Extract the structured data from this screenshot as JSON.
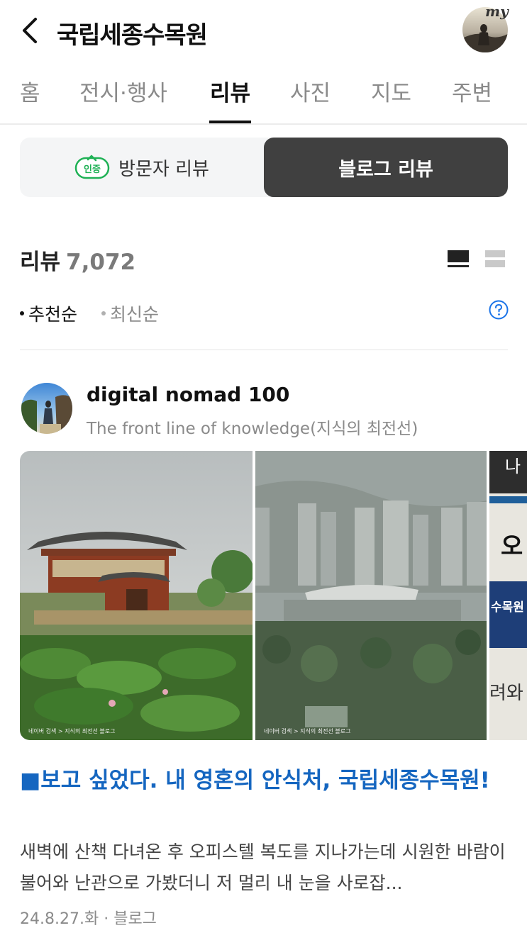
{
  "header": {
    "title": "국립세종수목원",
    "my_badge": "my"
  },
  "tabs": [
    {
      "label": "홈"
    },
    {
      "label": "전시·행사"
    },
    {
      "label": "리뷰"
    },
    {
      "label": "사진"
    },
    {
      "label": "지도"
    },
    {
      "label": "주변"
    }
  ],
  "active_tab": "리뷰",
  "review_toggle": {
    "badge_text": "인증",
    "visitor_label": "방문자 리뷰",
    "blog_label": "블로그 리뷰",
    "selected": "블로그 리뷰"
  },
  "reviews": {
    "label": "리뷰",
    "count": "7,072"
  },
  "sort": {
    "options": [
      "추천순",
      "최신순"
    ],
    "selected": "추천순"
  },
  "post": {
    "author_name": "digital nomad 100",
    "author_desc": "The front line of knowledge(지식의 최전선)",
    "title": "■보고 싶었다. 내 영혼의 안식처, 국립세종수목원!",
    "excerpt": "새벽에 산책 다녀온 후 오피스텔 복도를 지나가는데 시원한 바람이 불어와 난관으로 가봤더니 저 멀리 내 눈을 사로잡...",
    "date": "24.8.27.화",
    "source": "블로그",
    "meta_sep": " · ",
    "photo_watermark": "네이버 검색 > 지식의 최전선 블로그",
    "photo3_text": {
      "t1": "나",
      "t2": "오",
      "t3": "수목원",
      "t4": "려와"
    }
  },
  "colors": {
    "accent_blue": "#1566c0",
    "toggle_dark": "#404040",
    "cert_green": "#1fb155"
  },
  "icons": {
    "back": "chevron-left-icon",
    "view_list": "list-view-icon",
    "view_grid": "grid-view-icon",
    "help": "question-circle-icon"
  }
}
